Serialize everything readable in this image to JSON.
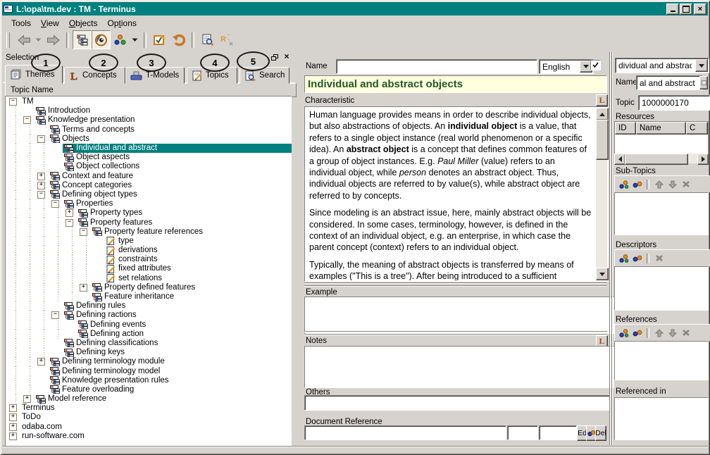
{
  "window": {
    "title": "L:\\opa\\tm.dev : TM - Terminus",
    "controls": {
      "minimize": "minimize",
      "maximize": "maximize",
      "close": "close"
    }
  },
  "menu": {
    "items": [
      {
        "label": "Tools",
        "u": -1
      },
      {
        "label": "View",
        "u": 0
      },
      {
        "label": "Objects",
        "u": 0
      },
      {
        "label": "Options",
        "u": 2
      }
    ]
  },
  "toolbar": {
    "buttons": [
      {
        "name": "back",
        "type": "button"
      },
      {
        "name": "back-dropdown",
        "type": "small"
      },
      {
        "name": "forward",
        "type": "button"
      },
      {
        "type": "sep"
      },
      {
        "name": "tree-view",
        "type": "button",
        "pressed": true
      },
      {
        "name": "eye-view",
        "type": "button",
        "pressed": true
      },
      {
        "name": "objects-dots",
        "type": "button"
      },
      {
        "name": "objects-dropdown",
        "type": "small"
      },
      {
        "type": "sep"
      },
      {
        "name": "edit-check",
        "type": "button"
      },
      {
        "name": "undo",
        "type": "button"
      },
      {
        "type": "sep"
      },
      {
        "name": "report-search",
        "type": "button"
      },
      {
        "name": "rename",
        "type": "button",
        "disabled": true
      }
    ]
  },
  "selection_panel": {
    "title": "Selection",
    "annotations": [
      "1",
      "2",
      "3",
      "4",
      "5"
    ],
    "tabs": [
      {
        "label": "Themes",
        "icon": "themes",
        "active": true
      },
      {
        "label": "Concepts",
        "icon": "concepts",
        "active": false
      },
      {
        "label": "T-Models",
        "icon": "tmodels",
        "active": false
      },
      {
        "label": "Topics",
        "icon": "topics",
        "active": false
      },
      {
        "label": "Search",
        "icon": "search",
        "active": false
      }
    ],
    "tree_header": "Topic Name",
    "tree": [
      {
        "label": "TM",
        "level": 0,
        "exp": "minus",
        "icon": null
      },
      {
        "label": "Introduction",
        "level": 1,
        "exp": null,
        "icon": "node"
      },
      {
        "label": "Knowledge presentation",
        "level": 1,
        "exp": "minus",
        "icon": "node"
      },
      {
        "label": "Terms and concepts",
        "level": 2,
        "exp": null,
        "icon": "node"
      },
      {
        "label": "Objects",
        "level": 2,
        "exp": "minus",
        "icon": "node"
      },
      {
        "label": "Individual and abstract",
        "level": 3,
        "exp": null,
        "icon": "node",
        "selected": true
      },
      {
        "label": "Object aspects",
        "level": 3,
        "exp": null,
        "icon": "node"
      },
      {
        "label": "Object collections",
        "level": 3,
        "exp": null,
        "icon": "node"
      },
      {
        "label": "Context and feature",
        "level": 2,
        "exp": "plus",
        "icon": "node"
      },
      {
        "label": "Concept categories",
        "level": 2,
        "exp": "plus",
        "icon": "node"
      },
      {
        "label": "Defining object types",
        "level": 2,
        "exp": "minus",
        "icon": "node"
      },
      {
        "label": "Properties",
        "level": 3,
        "exp": "minus",
        "icon": "node"
      },
      {
        "label": "Property types",
        "level": 4,
        "exp": "plus",
        "icon": "node"
      },
      {
        "label": "Property features",
        "level": 4,
        "exp": "minus",
        "icon": "node"
      },
      {
        "label": "Property feature references",
        "level": 5,
        "exp": "minus",
        "icon": "node"
      },
      {
        "label": "type",
        "level": 6,
        "exp": null,
        "icon": "pencil"
      },
      {
        "label": "derivations",
        "level": 6,
        "exp": null,
        "icon": "pencil"
      },
      {
        "label": "constraints",
        "level": 6,
        "exp": null,
        "icon": "pencil"
      },
      {
        "label": "fixed attributes",
        "level": 6,
        "exp": null,
        "icon": "pencil"
      },
      {
        "label": "set relations",
        "level": 6,
        "exp": null,
        "icon": "pencil"
      },
      {
        "label": "Property defined features",
        "level": 5,
        "exp": "plus",
        "icon": "node"
      },
      {
        "label": "Feature inheritance",
        "level": 5,
        "exp": null,
        "icon": "node"
      },
      {
        "label": "Defining rules",
        "level": 3,
        "exp": null,
        "icon": "node"
      },
      {
        "label": "Defining ractions",
        "level": 3,
        "exp": "minus",
        "icon": "node"
      },
      {
        "label": "Defining events",
        "level": 4,
        "exp": null,
        "icon": "node"
      },
      {
        "label": "Defining action",
        "level": 4,
        "exp": null,
        "icon": "node"
      },
      {
        "label": "Defining classifications",
        "level": 3,
        "exp": null,
        "icon": "node"
      },
      {
        "label": "Defining keys",
        "level": 3,
        "exp": null,
        "icon": "node"
      },
      {
        "label": "Defining terminology module",
        "level": 2,
        "exp": "plus",
        "icon": "node"
      },
      {
        "label": "Defining terminology model",
        "level": 2,
        "exp": null,
        "icon": "node"
      },
      {
        "label": "Knowledge presentation rules",
        "level": 2,
        "exp": null,
        "icon": "node"
      },
      {
        "label": "Feature overloading",
        "level": 2,
        "exp": null,
        "icon": "node"
      },
      {
        "label": "Model reference",
        "level": 1,
        "exp": "plus",
        "icon": "node"
      },
      {
        "label": "Terminus",
        "level": 0,
        "exp": "plus",
        "icon": null
      },
      {
        "label": "ToDo",
        "level": 0,
        "exp": "plus",
        "icon": null
      },
      {
        "label": "odaba.com",
        "level": 0,
        "exp": "plus",
        "icon": null
      },
      {
        "label": "run-software.com",
        "level": 0,
        "exp": "plus",
        "icon": null
      }
    ]
  },
  "editor": {
    "name_label": "Name",
    "name_value": "",
    "language_value": "English",
    "language_checked": true,
    "title": "Individual and abstract objects",
    "characteristic_label": "Characteristic",
    "characteristic_paragraphs": [
      {
        "runs": [
          {
            "t": "Human language provides means in order to describe individual objects, but also abstractions of objects. An "
          },
          {
            "t": "individual object",
            "b": true
          },
          {
            "t": " is a value, that refers to a single object instance (real world phenomenon or a specific idea). An "
          },
          {
            "t": "abstract object",
            "b": true
          },
          {
            "t": " is a concept that defines common features of a group of object instances. E.g. "
          },
          {
            "t": "Paul Miller",
            "i": true
          },
          {
            "t": " (value) refers to an individual object, while "
          },
          {
            "t": "person",
            "i": true
          },
          {
            "t": " denotes an abstract object. Thus, individual objects are referred to by value(s), while abstract object are referred to by concepts."
          }
        ]
      },
      {
        "runs": [
          {
            "t": "Since modeling is an abstract issue, here, mainly abstract objects will be considered. In some cases, terminology, however, is defined in the context of an individual object, e.g. an enterprise, in which case the parent concept (context) refers to an individual object."
          }
        ]
      },
      {
        "runs": [
          {
            "t": "Typically, the meaning of abstract objects is transferred by means of examples (\"This is a tree\"). After being introduced to a sufficient"
          }
        ]
      }
    ],
    "example_label": "Example",
    "example_value": "",
    "notes_label": "Notes",
    "notes_value": "",
    "others_label": "Others",
    "others_value": "",
    "docref_label": "Document Reference",
    "docref_value": "",
    "docref_page": "",
    "docref_pos": "",
    "docref_buttons": {
      "edit": "Ed",
      "delete": "Del"
    }
  },
  "properties_panel": {
    "topic_combo_value": "dividual and abstract",
    "name_label": "Name",
    "name_value": "al and abstract",
    "topic_label": "Topic",
    "topic_value": "1000000170",
    "resources": {
      "label": "Resources",
      "columns": [
        "ID",
        "Name",
        "C"
      ]
    },
    "subtopics": {
      "label": "Sub-Topics",
      "tools": [
        "molecule-add",
        "molecule",
        "sep",
        "up",
        "down",
        "delete"
      ]
    },
    "descriptors": {
      "label": "Descriptors",
      "tools": [
        "molecule-add",
        "molecule",
        "sep",
        "delete"
      ]
    },
    "references": {
      "label": "References",
      "tools": [
        "molecule-add",
        "molecule",
        "sep",
        "up",
        "down",
        "delete"
      ]
    },
    "referenced_in": {
      "label": "Referenced in"
    }
  },
  "colors": {
    "titlebar": "#00807E",
    "selection_highlight": "#00807E",
    "title_band_bg": "#FFFFDF",
    "title_band_text": "#215A21",
    "accent_orange": "#C87820"
  }
}
